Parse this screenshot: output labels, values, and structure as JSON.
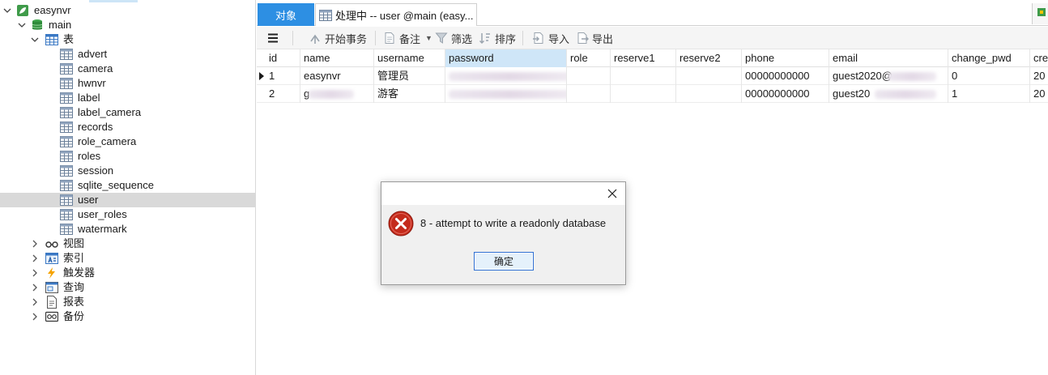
{
  "tree": {
    "root": "easynvr",
    "db": "main",
    "tables_group": "表",
    "tables": [
      "advert",
      "camera",
      "hwnvr",
      "label",
      "label_camera",
      "records",
      "role_camera",
      "roles",
      "session",
      "sqlite_sequence",
      "user",
      "user_roles",
      "watermark"
    ],
    "selected_table": "user",
    "groups": [
      "视图",
      "索引",
      "触发器",
      "查询",
      "报表",
      "备份"
    ]
  },
  "tabs": {
    "objects": "对象",
    "query": "处理中 -- user @main (easy..."
  },
  "toolbar": {
    "begin_transaction": "开始事务",
    "note": "备注",
    "filter": "筛选",
    "sort": "排序",
    "import": "导入",
    "export": "导出"
  },
  "grid": {
    "columns": [
      "id",
      "name",
      "username",
      "password",
      "role",
      "reserve1",
      "reserve2",
      "phone",
      "email",
      "change_pwd",
      "cre"
    ],
    "sorted_column": "password",
    "rows": [
      {
        "id": "1",
        "name": "easynvr",
        "username": "管理员",
        "password": "",
        "role": "",
        "reserve1": "",
        "reserve2": "",
        "phone": "00000000000",
        "email": "guest2020@",
        "change_pwd": "0",
        "cre": "20"
      },
      {
        "id": "2",
        "name": "g",
        "username": "游客",
        "password": "",
        "role": "",
        "reserve1": "",
        "reserve2": "",
        "phone": "00000000000",
        "email": "guest20",
        "change_pwd": "1",
        "cre": "20"
      }
    ]
  },
  "dialog": {
    "message": "8 - attempt to write a readonly database",
    "ok_label": "确定"
  },
  "colors": {
    "accent": "#2d8fe3",
    "selected_row": "#d9d9d9",
    "sorted_header": "#cfe6f8",
    "error_red": "#c42b1c"
  }
}
